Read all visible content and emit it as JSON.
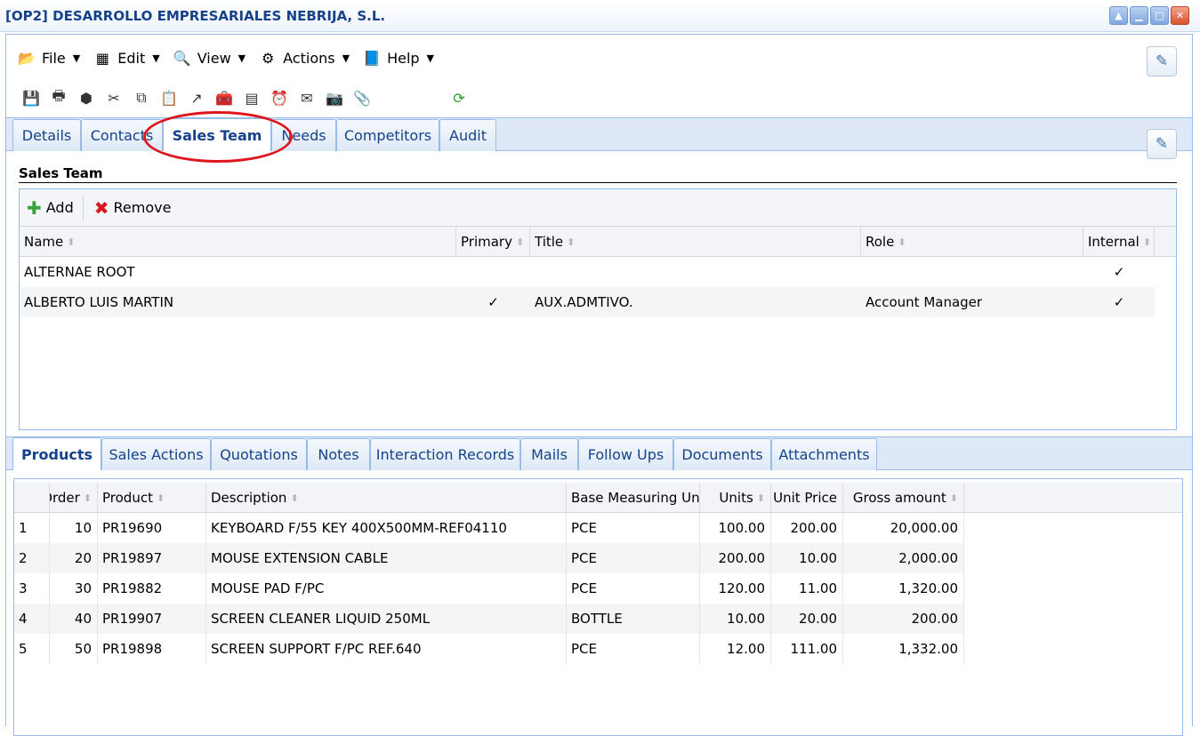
{
  "window": {
    "title": "[OP2] DESARROLLO EMPRESARIALES NEBRIJA, S.L."
  },
  "menu": [
    {
      "label": "File",
      "icon": "file-icon"
    },
    {
      "label": "Edit",
      "icon": "edit-icon"
    },
    {
      "label": "View",
      "icon": "view-icon"
    },
    {
      "label": "Actions",
      "icon": "actions-icon"
    },
    {
      "label": "Help",
      "icon": "help-icon"
    }
  ],
  "toolbar_icons": [
    "save-icon",
    "print-icon",
    "archive-icon",
    "cut-icon",
    "copy-icon",
    "paste-icon",
    "export-icon",
    "toolbox-icon",
    "calculator-icon",
    "alarm-icon",
    "mail-icon",
    "camera-icon",
    "attach-icon",
    "refresh-icon"
  ],
  "top_tabs": [
    "Details",
    "Contacts",
    "Sales Team",
    "Needs",
    "Competitors",
    "Audit"
  ],
  "top_active_tab": "Sales Team",
  "sales_team": {
    "title": "Sales Team",
    "add_label": "Add",
    "remove_label": "Remove",
    "columns": [
      "Name",
      "Primary",
      "Title",
      "Role",
      "Internal"
    ],
    "rows": [
      {
        "name": "ALTERNAE ROOT",
        "primary": "",
        "title": "",
        "role": "",
        "internal": "✓"
      },
      {
        "name": "ALBERTO LUIS MARTIN",
        "primary": "✓",
        "title": "AUX.ADMTIVO.",
        "role": "Account Manager",
        "internal": "✓"
      }
    ]
  },
  "bottom_tabs": [
    "Products",
    "Sales Actions",
    "Quotations",
    "Notes",
    "Interaction Records",
    "Mails",
    "Follow Ups",
    "Documents",
    "Attachments"
  ],
  "bottom_active_tab": "Products",
  "products": {
    "columns": [
      "Order",
      "Product",
      "Description",
      "Base Measuring Unit",
      "Units",
      "Unit Price",
      "Gross amount"
    ],
    "rows": [
      {
        "n": "1",
        "order": "10",
        "product": "PR19690",
        "description": "KEYBOARD F/55 KEY 400X500MM-REF04110",
        "unit": "PCE",
        "units": "100.00",
        "price": "200.00",
        "gross": "20,000.00"
      },
      {
        "n": "2",
        "order": "20",
        "product": "PR19897",
        "description": "MOUSE EXTENSION CABLE",
        "unit": "PCE",
        "units": "200.00",
        "price": "10.00",
        "gross": "2,000.00"
      },
      {
        "n": "3",
        "order": "30",
        "product": "PR19882",
        "description": "MOUSE PAD F/PC",
        "unit": "PCE",
        "units": "120.00",
        "price": "11.00",
        "gross": "1,320.00"
      },
      {
        "n": "4",
        "order": "40",
        "product": "PR19907",
        "description": "SCREEN CLEANER LIQUID 250ML",
        "unit": "BOTTLE",
        "units": "10.00",
        "price": "20.00",
        "gross": "200.00"
      },
      {
        "n": "5",
        "order": "50",
        "product": "PR19898",
        "description": "SCREEN SUPPORT F/PC REF.640",
        "unit": "PCE",
        "units": "12.00",
        "price": "111.00",
        "gross": "1,332.00"
      }
    ]
  },
  "colors": {
    "accent": "#15428b",
    "border": "#99bbe8",
    "tabstrip": "#dfe8f6",
    "highlight": "#e0141c"
  }
}
